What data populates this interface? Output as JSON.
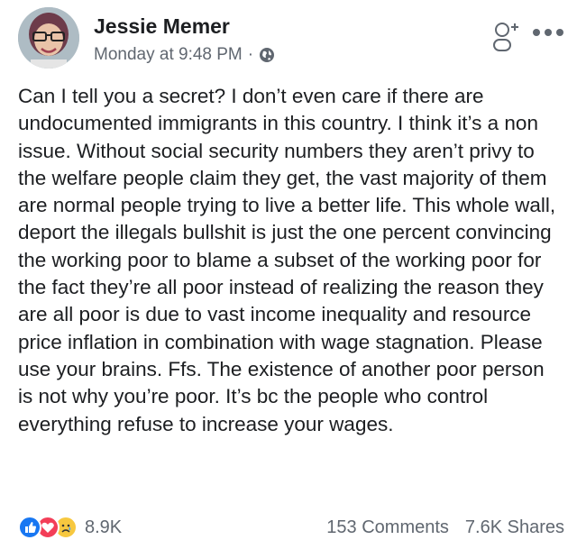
{
  "post": {
    "author_name": "Jessie Memer",
    "timestamp": "Monday at 9:48 PM",
    "separator": "·",
    "privacy_icon": "globe-icon",
    "text": "Can I tell you a secret? I don’t even care if there are undocumented immigrants in this country. I think it’s a non issue. Without social security numbers they aren’t privy to the welfare people claim they get, the vast majority of them are normal people trying to live a better life. This whole wall, deport the illegals bullshit is just the one percent convincing the working poor to blame a subset of the working poor for the fact they’re all poor instead of realizing the reason they are all poor is due to vast income inequality and resource price inflation in combination with wage stagnation. Please use your brains. Ffs. The existence of another poor person is not why you’re poor. It’s bc the people who control everything refuse to increase your wages."
  },
  "footer": {
    "reaction_icons": [
      "like-icon",
      "love-icon",
      "sad-icon"
    ],
    "reaction_count": "8.9K",
    "comments": "153 Comments",
    "shares": "7.6K Shares"
  },
  "colors": {
    "like": "#1877f2",
    "love": "#f33e58",
    "sad": "#f7c83f",
    "secondary_text": "#606770"
  }
}
